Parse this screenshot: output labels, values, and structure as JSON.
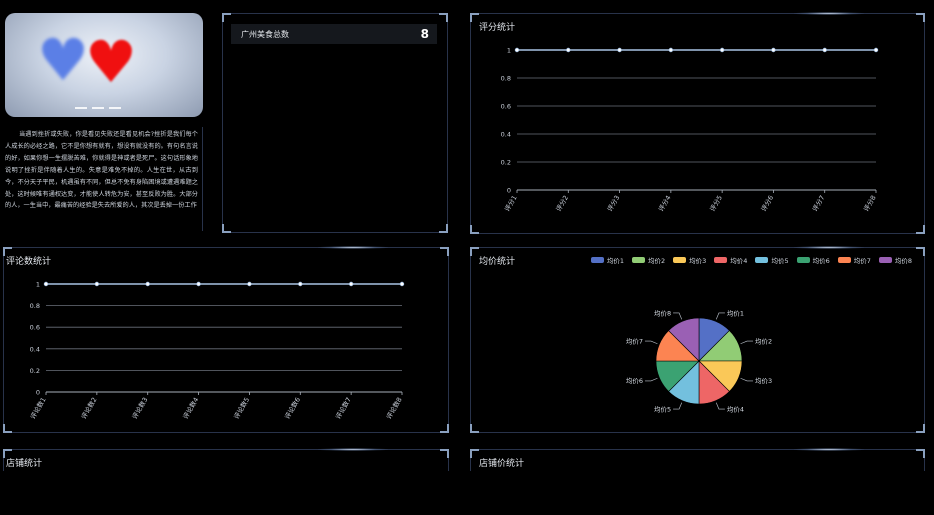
{
  "carousel": {
    "dot_count": 3
  },
  "article": {
    "text": "当遇到挫折或失败，你是看见失败还是看见机会?挫折是我们每个人成长的必经之路，它不是你想有就有，想没有就没有的。有句名言说的好，如果你想一生摆脱苦难，你就得是神或者是死尸。这句话形象地说明了挫折是伴随着人生的。失意是难免不掉的。人生在世，从古到今，不分天子平民，机遇虽有不同，但总不免有身陷困境或遭遇难题之处，这时候唯有通权达变，才能使人转危为安，甚至反败为胜。大部分的人，一生当中，最痛苦的经验是失去所爱的人，其次是丢掉一份工作"
  },
  "stat": {
    "label": "广州美食总数",
    "value": "8"
  },
  "rating_panel": {
    "title": "评分统计",
    "chart_data": {
      "type": "line",
      "title": "评分统计",
      "categories": [
        "评分1",
        "评分2",
        "评分3",
        "评分4",
        "评分5",
        "评分6",
        "评分7",
        "评分8"
      ],
      "values": [
        1,
        1,
        1,
        1,
        1,
        1,
        1,
        1
      ],
      "yticks": [
        "0",
        "0.2",
        "0.4",
        "0.6",
        "0.8",
        "1"
      ],
      "ylim": [
        0,
        1
      ],
      "grid": true
    }
  },
  "review_panel": {
    "title": "评论数统计",
    "chart_data": {
      "type": "line",
      "title": "评论数统计",
      "categories": [
        "评论数1",
        "评论数2",
        "评论数3",
        "评论数4",
        "评论数5",
        "评论数6",
        "评论数7",
        "评论数8"
      ],
      "values": [
        1,
        1,
        1,
        1,
        1,
        1,
        1,
        1
      ],
      "yticks": [
        "0",
        "0.2",
        "0.4",
        "0.6",
        "0.8",
        "1"
      ],
      "ylim": [
        0,
        1
      ],
      "grid": true
    }
  },
  "price_panel": {
    "title": "均价统计",
    "chart_data": {
      "type": "pie",
      "title": "均价统计",
      "labels": [
        "均价1",
        "均价2",
        "均价3",
        "均价4",
        "均价5",
        "均价6",
        "均价7",
        "均价8"
      ],
      "values": [
        1,
        1,
        1,
        1,
        1,
        1,
        1,
        1
      ],
      "colors": [
        "#5470c6",
        "#91cc75",
        "#fac858",
        "#ee6666",
        "#73c0de",
        "#3ba272",
        "#fc8452",
        "#9a60b4"
      ],
      "legend_position": "top-right"
    }
  },
  "bottom_left": {
    "title": "店铺统计"
  },
  "bottom_right": {
    "title": "店铺价统计"
  },
  "colors": {
    "line": "#a9c4e4",
    "grid": "#6b717b",
    "panel_border": "#28324a",
    "corner": "#8aa0bf"
  }
}
